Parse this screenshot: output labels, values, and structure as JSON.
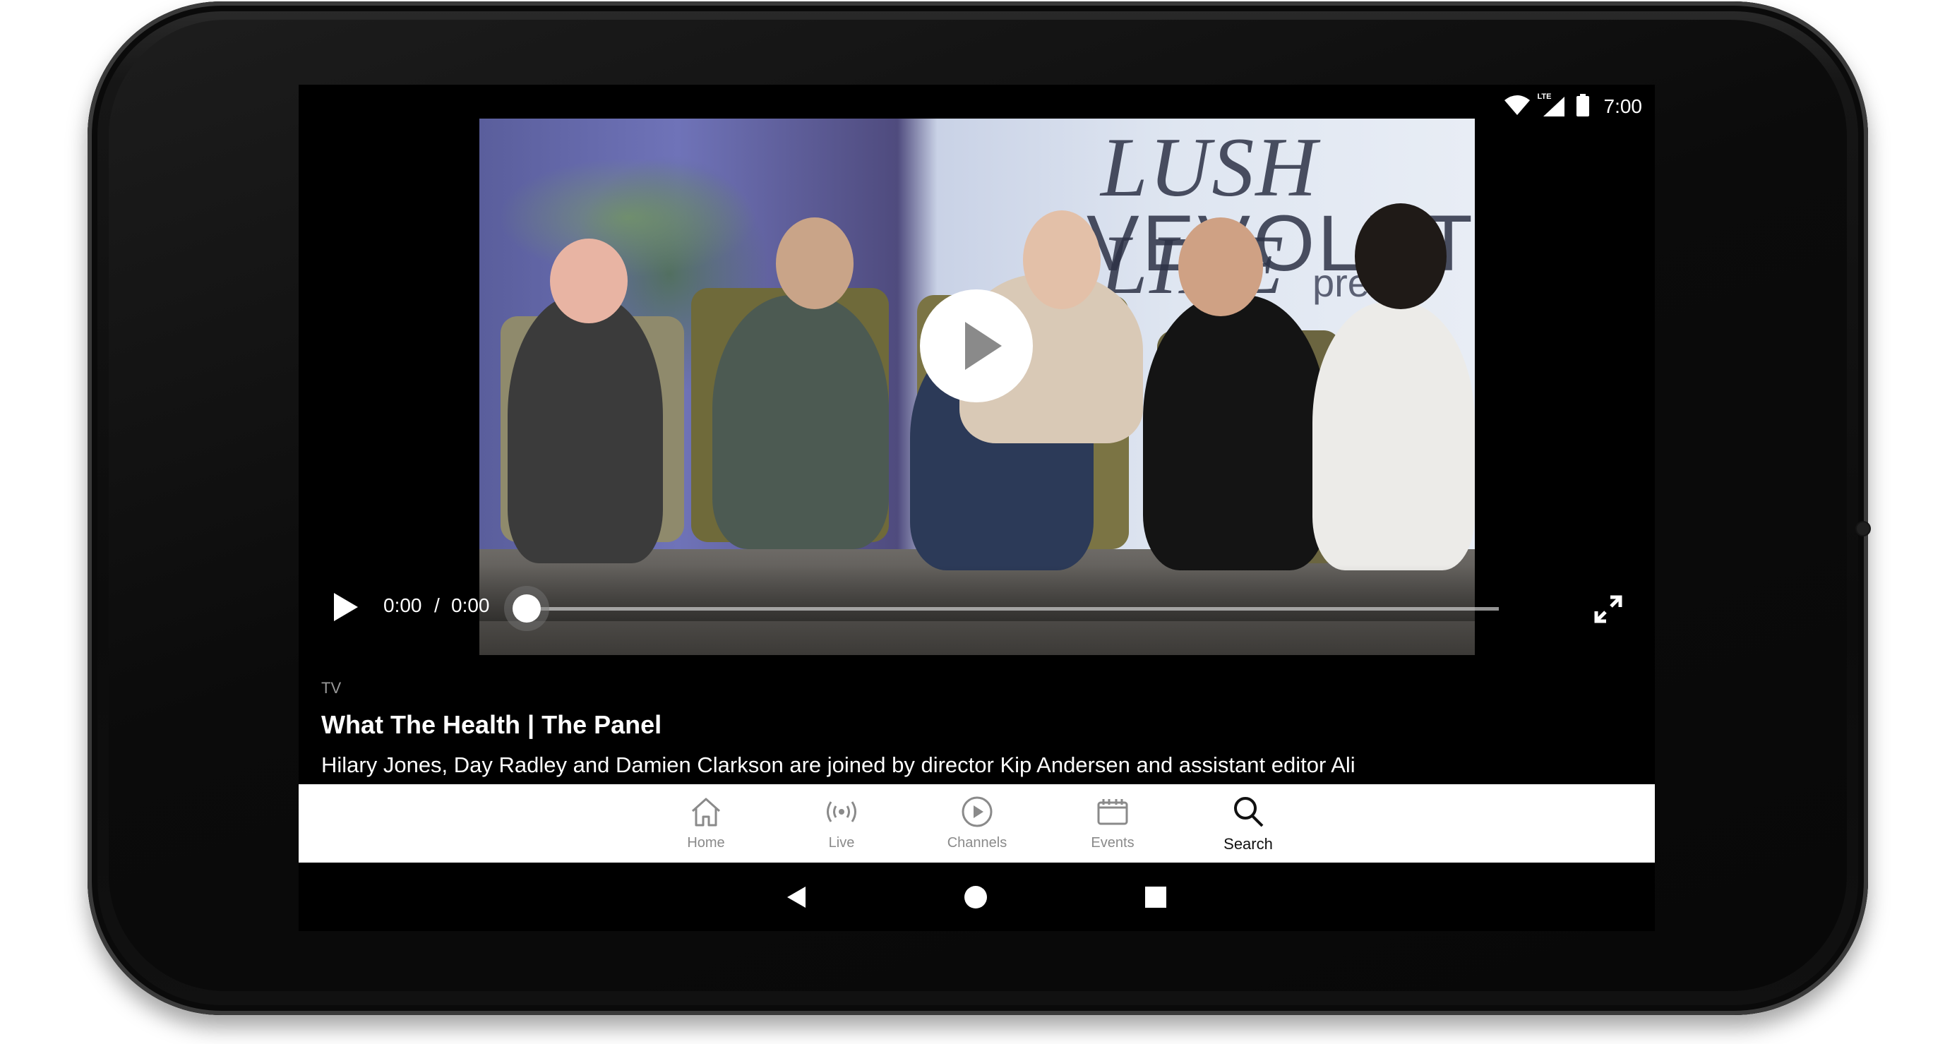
{
  "status_bar": {
    "time": "7:00",
    "network": "LTE",
    "icons": [
      "wifi-icon",
      "cell-signal-icon",
      "battery-icon"
    ]
  },
  "player": {
    "current_time": "0:00",
    "separator": "/",
    "duration": "0:00",
    "progress": 0,
    "icons": [
      "play-icon",
      "big-play-icon",
      "fullscreen-icon"
    ]
  },
  "video_frame": {
    "backdrop_line1": "LUSH LIFE",
    "backdrop_line2": "VEVOLUTION",
    "backdrop_line3": "prese"
  },
  "info": {
    "category": "TV",
    "title": "What The Health | The Panel",
    "description": "Hilary Jones, Day Radley and Damien Clarkson are joined by director Kip Andersen and assistant editor Ali"
  },
  "bottom_nav": {
    "items": [
      {
        "label": "Home",
        "icon": "home-icon",
        "active": false
      },
      {
        "label": "Live",
        "icon": "live-broadcast-icon",
        "active": false
      },
      {
        "label": "Channels",
        "icon": "play-circle-icon",
        "active": false
      },
      {
        "label": "Events",
        "icon": "calendar-icon",
        "active": false
      },
      {
        "label": "Search",
        "icon": "search-icon",
        "active": true
      }
    ]
  },
  "system_nav": {
    "icons": [
      "back-icon",
      "home-circle-icon",
      "recents-icon"
    ]
  },
  "colors": {
    "screen_background": "#000000",
    "nav_background": "#ffffff",
    "nav_inactive": "#8a8a8a",
    "nav_active": "#111111"
  }
}
